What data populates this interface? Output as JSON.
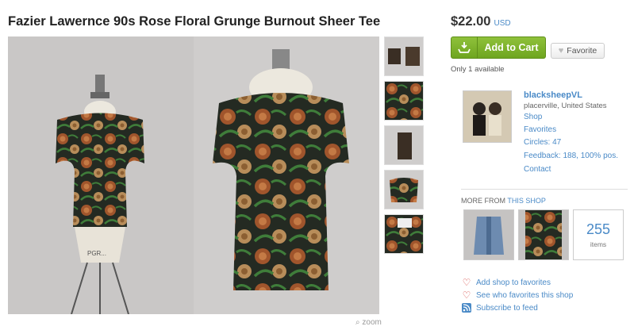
{
  "listing": {
    "title": "Fazier Lawernce 90s Rose Floral Grunge Burnout Sheer Tee",
    "price": "$22.00",
    "currency": "USD",
    "availability": "Only 1 available",
    "zoom_label": "zoom",
    "mannequin_tag": "PGR..."
  },
  "buttons": {
    "add_to_cart": "Add to Cart",
    "favorite": "Favorite"
  },
  "shop": {
    "name": "blacksheepVL",
    "location": "placerville, United States",
    "links": [
      "Shop",
      "Favorites",
      "Circles: 47",
      "Feedback: 188, 100% pos.",
      "Contact"
    ]
  },
  "more_from": {
    "prefix": "MORE FROM",
    "link": "THIS SHOP",
    "items_count": "255",
    "items_label": "items"
  },
  "actions": {
    "add_favorites": "Add shop to favorites",
    "see_favorites": "See who favorites this shop",
    "subscribe": "Subscribe to feed"
  },
  "colors": {
    "link": "#4a8ac7",
    "cart_green": "#7bb32e",
    "heart": "#d9534f",
    "feed": "#4a8ac7"
  }
}
